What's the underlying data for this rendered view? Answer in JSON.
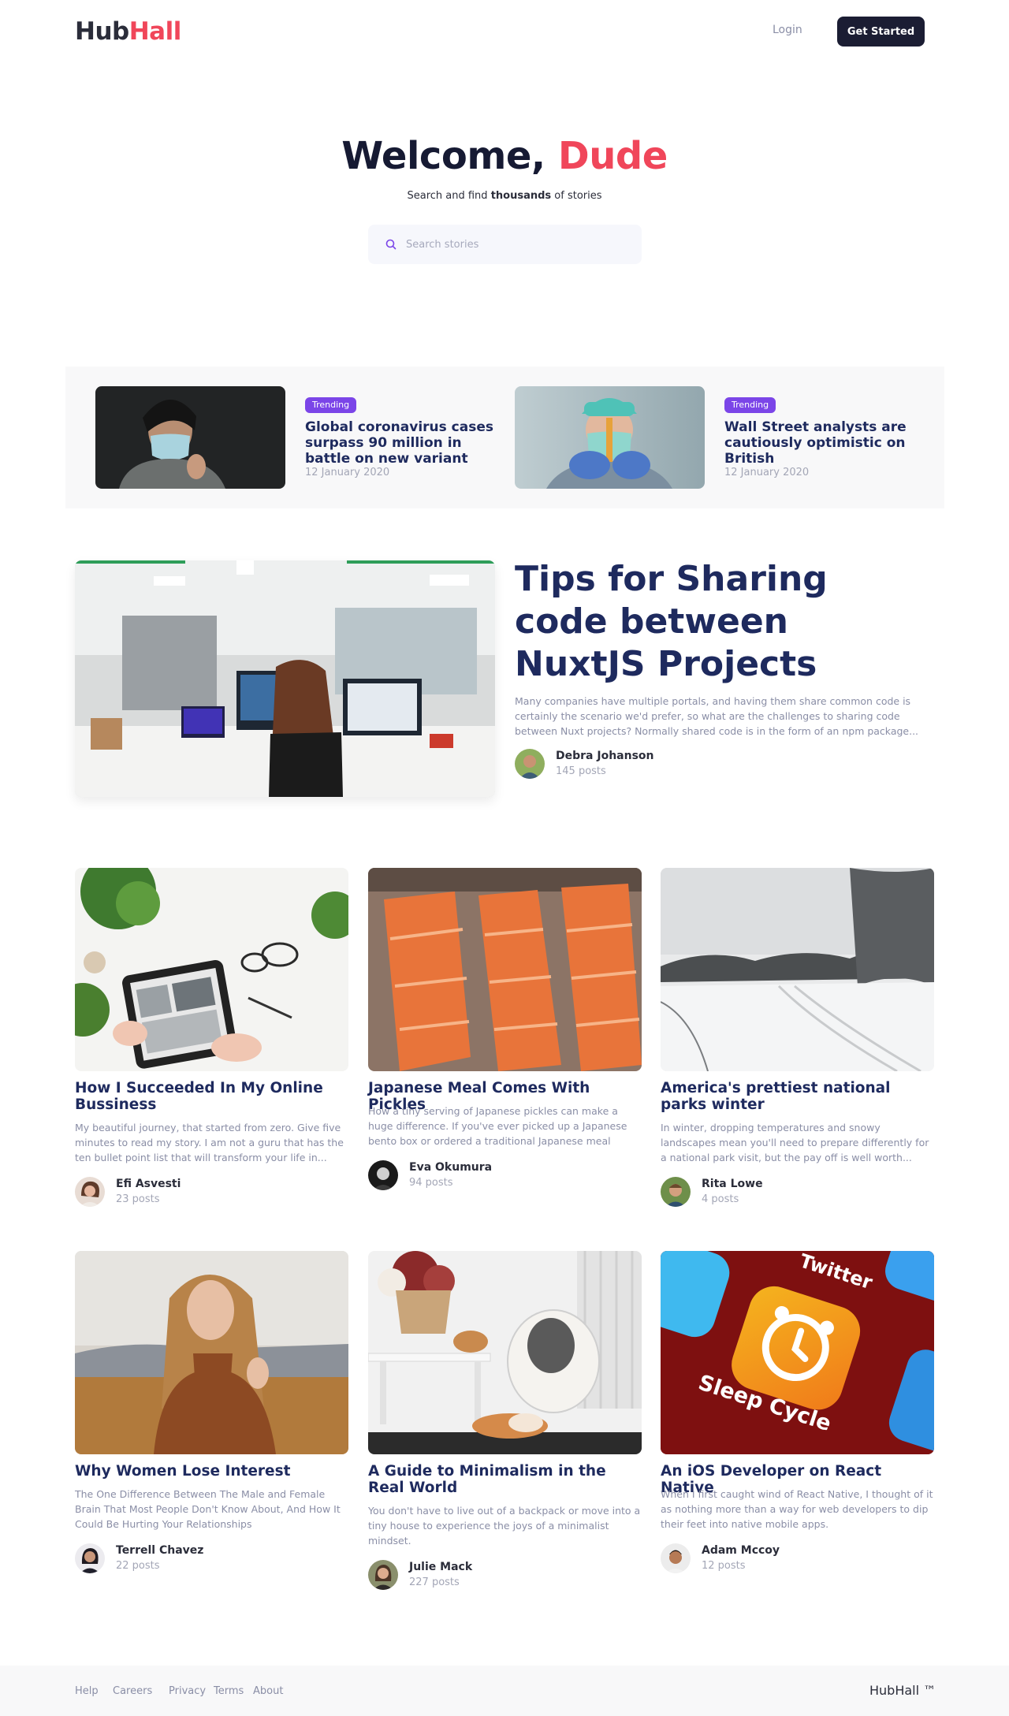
{
  "header": {
    "logo_part1": "Hub",
    "logo_part2": "Hall",
    "login_label": "Login",
    "get_started_label": "Get Started"
  },
  "hero": {
    "title_prefix": "Welcome, ",
    "title_name": "Dude",
    "subtitle_before": "Search and find ",
    "subtitle_bold": "thousands",
    "subtitle_after": " of stories",
    "search_placeholder": "Search stories",
    "search_icon": "search-icon"
  },
  "trending": [
    {
      "badge": "Trending",
      "title": "Global coronavirus cases surpass 90 million in battle on new variant",
      "date": "12 January 2020"
    },
    {
      "badge": "Trending",
      "title": "Wall Street analysts are cautiously optimistic on British",
      "date": "12 January 2020"
    }
  ],
  "featured": {
    "title": "Tips for Sharing code between NuxtJS Projects",
    "excerpt": "Many companies have multiple portals, and having them share common code is certainly the scenario we'd prefer, so what are the challenges to sharing code between Nuxt projects? Normally shared code is in the form of an npm package...",
    "author_name": "Debra Johanson",
    "author_posts": "145 posts"
  },
  "cards": [
    {
      "title": "How I Succeeded In My Online Bussiness",
      "excerpt": "My beautiful journey, that started from zero. Give five minutes to read my story. I am not a guru that has the ten bullet point list that will transform your life in...",
      "author_name": "Efi Asvesti",
      "author_posts": "23 posts"
    },
    {
      "title": "Japanese Meal Comes With Pickles",
      "excerpt": "How a tiny serving of Japanese pickles can make a huge difference. If you've ever picked up a Japanese bento box or ordered a traditional Japanese meal",
      "author_name": "Eva Okumura",
      "author_posts": "94 posts"
    },
    {
      "title": "America's prettiest national parks winter",
      "excerpt": "In winter, dropping temperatures and snowy landscapes mean you'll need to prepare differently for a national park visit, but the pay off is well worth...",
      "author_name": "Rita Lowe",
      "author_posts": "4 posts"
    },
    {
      "title": "Why Women Lose Interest",
      "excerpt": "The One Difference Between The Male and Female Brain That Most People Don't Know About, And How It Could Be Hurting Your Relationships",
      "author_name": "Terrell Chavez",
      "author_posts": "22 posts"
    },
    {
      "title": "A Guide to Minimalism in the Real World",
      "excerpt": "You don't have to live out of a backpack or move into a tiny house to experience the joys of a minimalist mindset.",
      "author_name": "Julie Mack",
      "author_posts": "227 posts"
    },
    {
      "title": "An iOS Developer on React Native",
      "excerpt": "When I first caught wind of React Native, I thought of it as nothing more than a way for web developers to dip their feet into native mobile apps.",
      "author_name": "Adam Mccoy",
      "author_posts": "12 posts"
    }
  ],
  "card_image_texts": {
    "twitter": "Twitter",
    "sleep_cycle": "Sleep Cycle"
  },
  "footer": {
    "links": [
      "Help",
      "Careers",
      "Privacy",
      "Terms",
      "About"
    ],
    "brand": "HubHall ™"
  },
  "colors": {
    "accent": "#f0465a",
    "dark": "#1b1d33",
    "title_blue": "#1e2a5e",
    "badge_purple": "#7b45e8",
    "muted": "#8a8ea6"
  }
}
